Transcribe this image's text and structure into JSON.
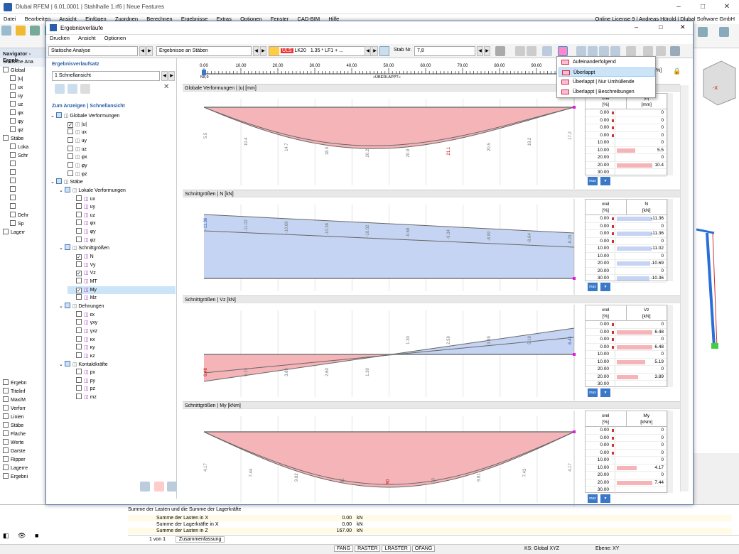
{
  "app": {
    "title": "Dlubal RFEM | 6.01.0001 | Stahlhalle 1.rf6 | Neue Features",
    "license": "Online License 9 | Andreas Hörold | Dlubal Software GmbH"
  },
  "menu": [
    "Datei",
    "Bearbeiten",
    "Ansicht",
    "Einfügen",
    "Zuordnen",
    "Berechnen",
    "Ergebnisse",
    "Extras",
    "Optionen",
    "Fenster",
    "CAD-BIM",
    "Hilfe"
  ],
  "navigator": {
    "title": "Navigator - Ergeb",
    "combo": "Statische Ana",
    "items": [
      "Global",
      "|u|",
      "ux",
      "uy",
      "uz",
      "φx",
      "φy",
      "φz",
      "Stäbe",
      "Loka",
      "Schr",
      "",
      "",
      "",
      "",
      "",
      "",
      "Dehr",
      "Sp",
      "Lagerr"
    ],
    "bottom_items": [
      "Ergebn",
      "Titelinf",
      "Max/M",
      "Verforr",
      "Linien",
      "Stäbe",
      "Fläche",
      "Werte",
      "Darste",
      "Ripper",
      "Lagerre",
      "Ergebni"
    ]
  },
  "dialog": {
    "title": "Ergebnisverläufe",
    "menu": [
      "Drucken",
      "Ansicht",
      "Optionen"
    ],
    "analysis": "Statische Analyse",
    "results": "Ergebnisse an Stäben",
    "uls": "ULS",
    "lk": "LK20",
    "lk_formula": "1.35 * LF1 + ...",
    "member_label": "Stab Nr.",
    "member_value": "7,8",
    "set_label": "Ergebnisverlaufsatz",
    "set_value": "1   Schnellansicht",
    "show_label": "Zum Anzeigen | Schnellansicht",
    "ruler_ticks": [
      "0.00",
      "10.00",
      "20.00",
      "30.00",
      "40.00",
      "50.00",
      "60.00",
      "70.00",
      "80.00",
      "90.00"
    ],
    "ruler_pct": "[%]",
    "ruler_node": "N8,9",
    "ruler_caption": "»ÜBERLAPPT«",
    "dropdown": [
      "Aufeinanderfolgend",
      "Überlappt",
      "Überlappt | Nur Umhüllende",
      "Überlappt | Beschreibungen"
    ]
  },
  "tree": [
    {
      "label": "Globale Verformungen",
      "level": 1,
      "kind": "group"
    },
    {
      "label": "|u|",
      "level": 2,
      "checked": true
    },
    {
      "label": "ux",
      "level": 2
    },
    {
      "label": "uy",
      "level": 2
    },
    {
      "label": "uz",
      "level": 2
    },
    {
      "label": "φx",
      "level": 2
    },
    {
      "label": "φy",
      "level": 2
    },
    {
      "label": "φz",
      "level": 2
    },
    {
      "label": "Stäbe",
      "level": 1,
      "kind": "group"
    },
    {
      "label": "Lokale Verformungen",
      "level": 2,
      "kind": "group"
    },
    {
      "label": "ux",
      "level": 3
    },
    {
      "label": "uy",
      "level": 3
    },
    {
      "label": "uz",
      "level": 3
    },
    {
      "label": "φx",
      "level": 3
    },
    {
      "label": "φy",
      "level": 3
    },
    {
      "label": "φz",
      "level": 3
    },
    {
      "label": "Schnittgrößen",
      "level": 2,
      "kind": "group"
    },
    {
      "label": "N",
      "level": 3,
      "checked": true
    },
    {
      "label": "Vy",
      "level": 3
    },
    {
      "label": "Vz",
      "level": 3,
      "checked": true
    },
    {
      "label": "MT",
      "level": 3
    },
    {
      "label": "My",
      "level": 3,
      "checked": true,
      "selected": true
    },
    {
      "label": "Mz",
      "level": 3
    },
    {
      "label": "Dehnungen",
      "level": 2,
      "kind": "group"
    },
    {
      "label": "εx",
      "level": 3
    },
    {
      "label": "γxy",
      "level": 3
    },
    {
      "label": "γxz",
      "level": 3
    },
    {
      "label": "κx",
      "level": 3
    },
    {
      "label": "κy",
      "level": 3
    },
    {
      "label": "κz",
      "level": 3
    },
    {
      "label": "Kontaktkräfte",
      "level": 2,
      "kind": "group"
    },
    {
      "label": "px",
      "level": 3
    },
    {
      "label": "py",
      "level": 3
    },
    {
      "label": "pz",
      "level": 3
    },
    {
      "label": "mz",
      "level": 3
    }
  ],
  "panels": [
    {
      "title": "Globale Verformungen | |u| [mm]",
      "col2": "|u|",
      "unit": "[mm]",
      "labels": [
        "5.5",
        "10.4",
        "14.7",
        "18.0",
        "20.2",
        "20.9",
        "21.1",
        "20.5",
        "19.2",
        "17.2"
      ],
      "rows": [
        [
          "0.00",
          "0"
        ],
        [
          "0.00",
          "0"
        ],
        [
          "0.00",
          "0"
        ],
        [
          "0.00",
          "0"
        ],
        [
          "10.00",
          "0"
        ],
        [
          "10.00",
          "5.5"
        ],
        [
          "20.00",
          "0"
        ],
        [
          "20.00",
          "10.4"
        ],
        [
          "30.00",
          ""
        ]
      ]
    },
    {
      "title": "Schnittgrößen | N [kN]",
      "col2": "N",
      "unit": "[kN]",
      "labels": [
        "-11.36",
        "-11.02",
        "-10.69",
        "-10.36",
        "-10.02",
        "-9.68",
        "-9.34",
        "-8.99",
        "-8.64",
        "-8.29"
      ],
      "rows": [
        [
          "0.00",
          "-11.36"
        ],
        [
          "0.00",
          "0"
        ],
        [
          "0.00",
          "-11.36"
        ],
        [
          "0.00",
          "0"
        ],
        [
          "10.00",
          "-11.02"
        ],
        [
          "10.00",
          "0"
        ],
        [
          "20.00",
          "-10.69"
        ],
        [
          "20.00",
          "0"
        ],
        [
          "30.00",
          "-10.36"
        ]
      ]
    },
    {
      "title": "Schnittgrößen | Vz [kN]",
      "col2": "Vz",
      "unit": "[kN]",
      "labels": [
        "6.48",
        "5.19",
        "3.89",
        "2.60",
        "1.30",
        "1.30",
        "2.59",
        "3.89",
        "5.18",
        "6.41"
      ],
      "rows": [
        [
          "0.00",
          "0"
        ],
        [
          "0.00",
          "6.48"
        ],
        [
          "0.00",
          "0"
        ],
        [
          "0.00",
          "6.48"
        ],
        [
          "10.00",
          "0"
        ],
        [
          "10.00",
          "5.19"
        ],
        [
          "20.00",
          "0"
        ],
        [
          "20.00",
          "3.89"
        ],
        [
          "30.00",
          ""
        ]
      ]
    },
    {
      "title": "Schnittgrößen | My [kNm]",
      "col2": "My",
      "unit": "[kNm]",
      "labels": [
        "4.17",
        "7.44",
        "9.82",
        "31",
        "90",
        "30",
        "9.81",
        "7.43",
        "4.17"
      ],
      "rows": [
        [
          "0.00",
          "0"
        ],
        [
          "0.00",
          "0"
        ],
        [
          "0.00",
          "0"
        ],
        [
          "0.00",
          "0"
        ],
        [
          "10.00",
          "0"
        ],
        [
          "10.00",
          "4.17"
        ],
        [
          "20.00",
          "0"
        ],
        [
          "20.00",
          "7.44"
        ],
        [
          "30.00",
          ""
        ]
      ]
    }
  ],
  "xrel": "xrel",
  "pct": "[%]",
  "max": "max",
  "summary": {
    "title": "Summe der Lasten und die Summe der Lagerkräfte",
    "rows": [
      [
        "Summe der Lasten in X",
        "0.00",
        "kN"
      ],
      [
        "Summe der Lagerkräfte in X",
        "0.00",
        "kN"
      ],
      [
        "Summe der Lasten in Z",
        "167.00",
        "kN"
      ]
    ],
    "pager": "1 von 1",
    "tab": "Zusammenfassung"
  },
  "status": {
    "buttons": [
      "FANG",
      "RASTER",
      "LRASTER",
      "OFANG"
    ],
    "ks": "KS: Global XYZ",
    "ebene": "Ebene: XY"
  },
  "colors": {
    "positive": "#f4b4b8",
    "negative": "#c5d4f2",
    "accent": "#3a78c8"
  }
}
